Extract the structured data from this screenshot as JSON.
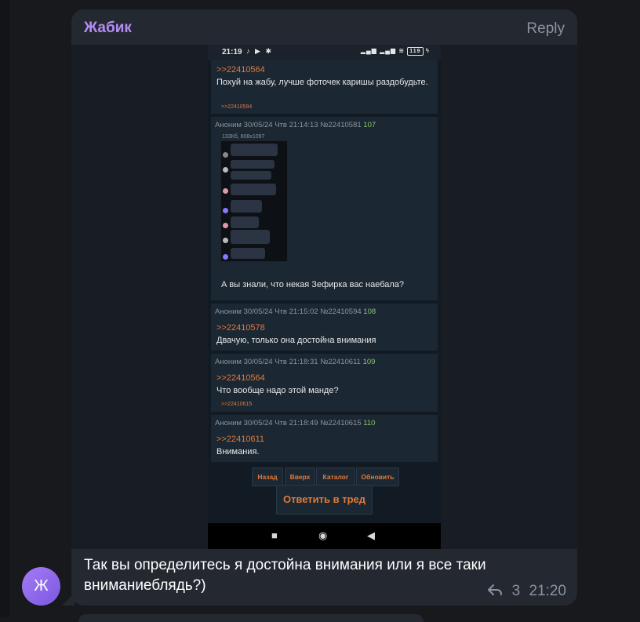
{
  "message": {
    "sender": "Жабик",
    "reply_label": "Reply",
    "caption": "Так вы определитесь я достойна внимания или я все таки вниманиеблядь?)",
    "reply_count": "3",
    "time": "21:20",
    "avatar_letter": "Ж"
  },
  "screenshot": {
    "status": {
      "time": "21:19",
      "battery": "119"
    },
    "posts": [
      {
        "ref": ">>22410564",
        "text": "Похуй на жабу, лучше фоточек каришы раздобудьте.",
        "backref": ">>22410594"
      },
      {
        "meta": "Аноним  30/05/24 Чтв 21:14:13  №22410581",
        "num": "107",
        "file_info": "133Кб, 608x1097",
        "text": "А вы знали, что некая Зефирка вас наебала?"
      },
      {
        "meta": "Аноним  30/05/24 Чтв 21:15:02  №22410594",
        "num": "108",
        "ref": ">>22410578",
        "text": "Двачую, только она достойна внимания"
      },
      {
        "meta": "Аноним  30/05/24 Чтв 21:18:31  №22410611",
        "num": "109",
        "ref": ">>22410564",
        "text": "Что вообще надо этой манде?",
        "backref": ">>22410615"
      },
      {
        "meta": "Аноним  30/05/24 Чтв 21:18:49  №22410615",
        "num": "110",
        "ref": ">>22410611",
        "text": "Внимания."
      }
    ],
    "nav_buttons": [
      "Назад",
      "Вверх",
      "Каталог",
      "Обновить"
    ],
    "reply_button": "Ответить в тред",
    "navbar": {
      "square": "■",
      "circle": "◉",
      "back": "◀"
    }
  },
  "colors": {
    "accent_name": "#b48cf5",
    "link": "#e07a3a",
    "post_number": "#8fc46b",
    "bubble": "#242931"
  },
  "icons": [
    "reply-arrow-icon",
    "tiktok-icon",
    "youtube-icon",
    "wifi-icon",
    "signal-icon",
    "battery-icon"
  ]
}
